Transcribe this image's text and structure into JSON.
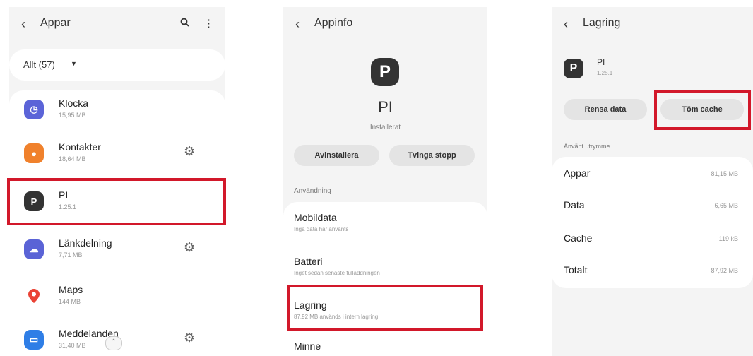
{
  "panel1": {
    "back_icon": "chevron-left-icon",
    "title": "Appar",
    "filter_label": "Allt (57)",
    "apps": [
      {
        "name": "Klocka",
        "size": "15,95 MB",
        "color": "#5b64d8",
        "glyph": "◷",
        "gear": false
      },
      {
        "name": "Kontakter",
        "size": "18,64 MB",
        "color": "#f0812c",
        "glyph": "●",
        "gear": true
      },
      {
        "name": "PI",
        "size": "1.25.1",
        "color": "#333333",
        "glyph": "P",
        "gear": false
      },
      {
        "name": "Länkdelning",
        "size": "7,71 MB",
        "color": "#5a63d6",
        "glyph": "☁",
        "gear": true
      },
      {
        "name": "Maps",
        "size": "144 MB",
        "color": "#ffffff",
        "glyph": "📍",
        "gear": false
      },
      {
        "name": "Meddelanden",
        "size": "31,40 MB",
        "color": "#2f7ee6",
        "glyph": "▭",
        "gear": true
      }
    ]
  },
  "panel2": {
    "title": "Appinfo",
    "app_icon_letter": "P",
    "app_name": "PI",
    "status": "Installerat",
    "uninstall_label": "Avinstallera",
    "force_stop_label": "Tvinga stopp",
    "section_label": "Användning",
    "items": [
      {
        "title": "Mobildata",
        "subtitle": "Inga data har använts"
      },
      {
        "title": "Batteri",
        "subtitle": "Inget sedan senaste fulladdningen"
      },
      {
        "title": "Lagring",
        "subtitle": "87,92 MB används i intern lagring"
      },
      {
        "title": "Minne",
        "subtitle": ""
      }
    ]
  },
  "panel3": {
    "title": "Lagring",
    "app_icon_letter": "P",
    "app_name": "PI",
    "app_version": "1.25.1",
    "clear_data_label": "Rensa data",
    "clear_cache_label": "Töm cache",
    "used_space_label": "Använt utrymme",
    "rows": [
      {
        "label": "Appar",
        "value": "81,15 MB"
      },
      {
        "label": "Data",
        "value": "6,65 MB"
      },
      {
        "label": "Cache",
        "value": "119 kB"
      },
      {
        "label": "Totalt",
        "value": "87,92 MB"
      }
    ]
  },
  "highlight_color": "#d2182a"
}
